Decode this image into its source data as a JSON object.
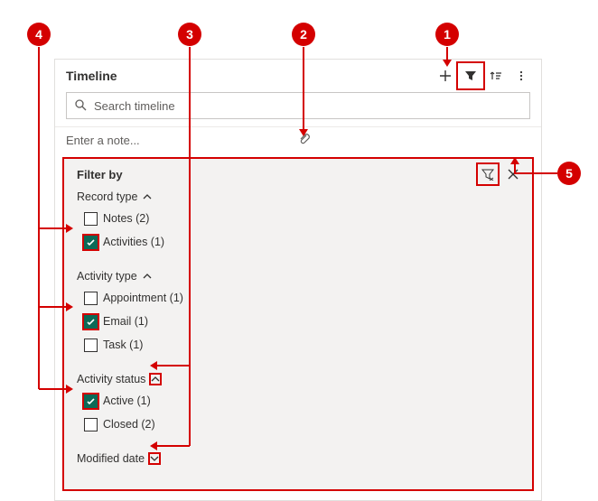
{
  "header": {
    "title": "Timeline"
  },
  "search": {
    "placeholder": "Search timeline"
  },
  "note": {
    "placeholder": "Enter a note..."
  },
  "filter": {
    "title": "Filter by",
    "sections": {
      "record_type": {
        "label": "Record type",
        "expanded": true,
        "options": [
          {
            "label": "Notes (2)",
            "checked": false
          },
          {
            "label": "Activities (1)",
            "checked": true
          }
        ]
      },
      "activity_type": {
        "label": "Activity type",
        "expanded": true,
        "options": [
          {
            "label": "Appointment (1)",
            "checked": false
          },
          {
            "label": "Email (1)",
            "checked": true
          },
          {
            "label": "Task (1)",
            "checked": false
          }
        ]
      },
      "activity_status": {
        "label": "Activity status",
        "expanded": true,
        "options": [
          {
            "label": "Active (1)",
            "checked": true
          },
          {
            "label": "Closed (2)",
            "checked": false
          }
        ]
      },
      "modified_date": {
        "label": "Modified date",
        "expanded": false
      }
    }
  },
  "callouts": {
    "1": "1",
    "2": "2",
    "3": "3",
    "4": "4",
    "5": "5"
  }
}
